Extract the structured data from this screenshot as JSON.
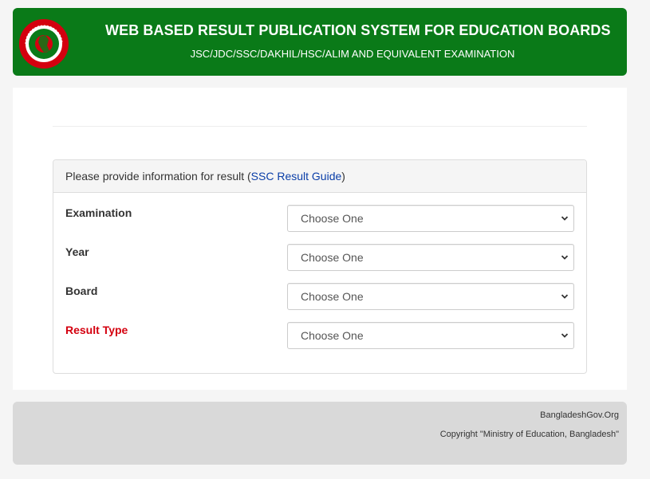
{
  "header": {
    "title": "WEB BASED RESULT PUBLICATION SYSTEM FOR EDUCATION BOARDS",
    "subtitle": "JSC/JDC/SSC/DAKHIL/HSC/ALIM AND EQUIVALENT EXAMINATION",
    "logo_icon": "government-seal-icon",
    "colors": {
      "header_bg": "#0a7a18",
      "seal_red": "#d4000f",
      "seal_green": "#0a7a18"
    }
  },
  "panel": {
    "heading_prefix": "Please provide information for result (",
    "guide_link": "SSC Result Guide",
    "heading_suffix": ")",
    "fields": [
      {
        "label": "Examination",
        "value": "Choose One",
        "label_color": "#333333"
      },
      {
        "label": "Year",
        "value": "Choose One",
        "label_color": "#333333"
      },
      {
        "label": "Board",
        "value": "Choose One",
        "label_color": "#333333"
      },
      {
        "label": "Result Type",
        "value": "Choose One",
        "label_color": "#d4000f"
      }
    ]
  },
  "footer": {
    "site": "BangladeshGov.Org",
    "copyright": "Copyright \"Ministry of Education, Bangladesh\""
  }
}
